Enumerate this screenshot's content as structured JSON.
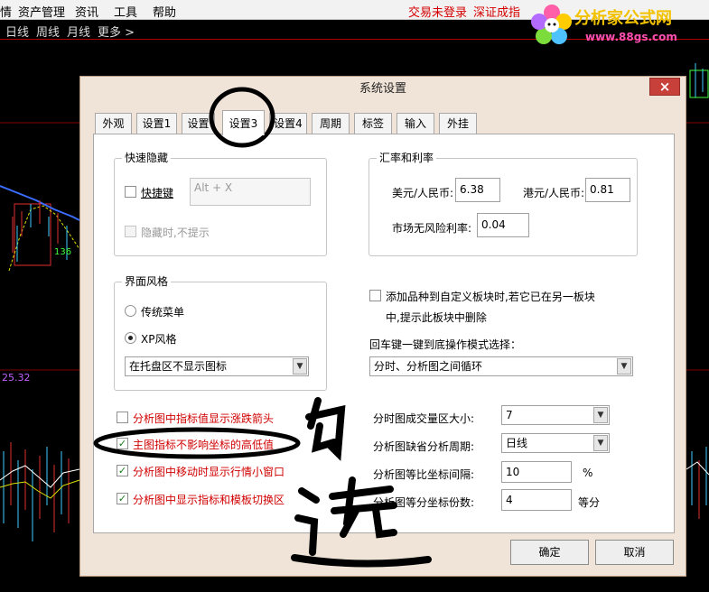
{
  "menubar": {
    "items": [
      "情",
      "资产管理",
      "资讯",
      "工具",
      "帮助"
    ],
    "trade_status": "交易未登录",
    "market_link": "深证成指"
  },
  "period_bar": {
    "items": [
      "日线",
      "周线",
      "月线",
      "更多 >"
    ]
  },
  "logo": {
    "title": "分析家公式网",
    "url": "www.88gs.com"
  },
  "chart": {
    "price_label": "25.32"
  },
  "dialog": {
    "title": "系统设置",
    "close": "×",
    "tabs": [
      "外观",
      "设置1",
      "设置",
      "设置3",
      "设置4",
      "周期",
      "标签",
      "输入",
      "外挂"
    ],
    "active_tab": "设置3",
    "quick_hide": {
      "title": "快速隐藏",
      "hotkey_label": "快捷键",
      "hotkey_value": "Alt + X",
      "hotkey_checked": false,
      "no_prompt_label": "隐藏时,不提示",
      "no_prompt_checked": false
    },
    "rates": {
      "title": "汇率和利率",
      "usd_label": "美元/人民币:",
      "usd_value": "6.38",
      "hkd_label": "港元/人民币:",
      "hkd_value": "0.81",
      "riskfree_label": "市场无风险利率:",
      "riskfree_value": "0.04"
    },
    "style": {
      "title": "界面风格",
      "option_classic": "传统菜单",
      "option_xp": "XP风格",
      "selected": "XP风格",
      "tray_select": "在托盘区不显示图标"
    },
    "custom_block": {
      "line1": "添加品种到自定义板块时,若它已在另一板块",
      "line2": "中,提示此板块中删除",
      "checked": false
    },
    "enter_mode": {
      "label": "回车键一键到底操作模式选择：",
      "value": "分时、分析图之间循环"
    },
    "chart_options": [
      {
        "label": "分析图中指标值显示涨跌箭头",
        "checked": false
      },
      {
        "label": "主图指标不影响坐标的高低值",
        "checked": true
      },
      {
        "label": "分析图中移动时显示行情小窗口",
        "checked": true
      },
      {
        "label": "分析图中显示指标和模板切换区",
        "checked": true
      }
    ],
    "right_options": {
      "volume_label": "分时图成交量区大小:",
      "volume_value": "7",
      "period_label": "分析图缺省分析周期:",
      "period_value": "日线",
      "ratio_label": "分析图等比坐标间隔:",
      "ratio_value": "10",
      "ratio_unit": "%",
      "divide_label": "分析图等分坐标份数:",
      "divide_value": "4",
      "divide_unit": "等分"
    },
    "ok": "确定",
    "cancel": "取消"
  },
  "annotation": {
    "handwritten": "勾选"
  }
}
